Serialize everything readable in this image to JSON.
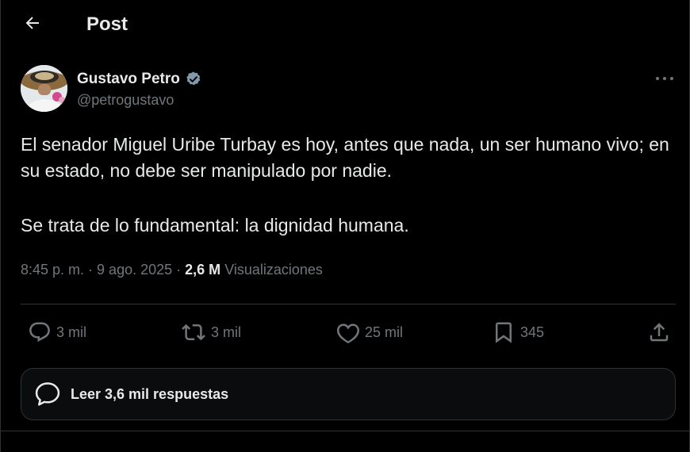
{
  "header": {
    "back_icon": "arrow-left-icon",
    "title": "Post"
  },
  "author": {
    "name": "Gustavo Petro",
    "handle": "@petrogustavo",
    "verified_badge_color": "#829aab"
  },
  "post": {
    "paragraph1": "El senador Miguel Uribe Turbay es hoy, antes que nada, un ser humano vivo; en su estado, no debe ser manipulado por nadie.",
    "paragraph2": "Se trata de lo fundamental: la dignidad humana."
  },
  "meta": {
    "time": "8:45 p. m.",
    "separator": " · ",
    "date": "9 ago. 2025",
    "views_count": "2,6 M",
    "views_label": "Visualizaciones"
  },
  "actions": {
    "replies": "3 mil",
    "reposts": "3 mil",
    "likes": "25 mil",
    "bookmarks": "345"
  },
  "replies_card": {
    "label": "Leer 3,6 mil respuestas"
  },
  "colors": {
    "background": "#000000",
    "text_primary": "#e7e9ea",
    "text_secondary": "#71767b",
    "border": "#2f3336"
  }
}
